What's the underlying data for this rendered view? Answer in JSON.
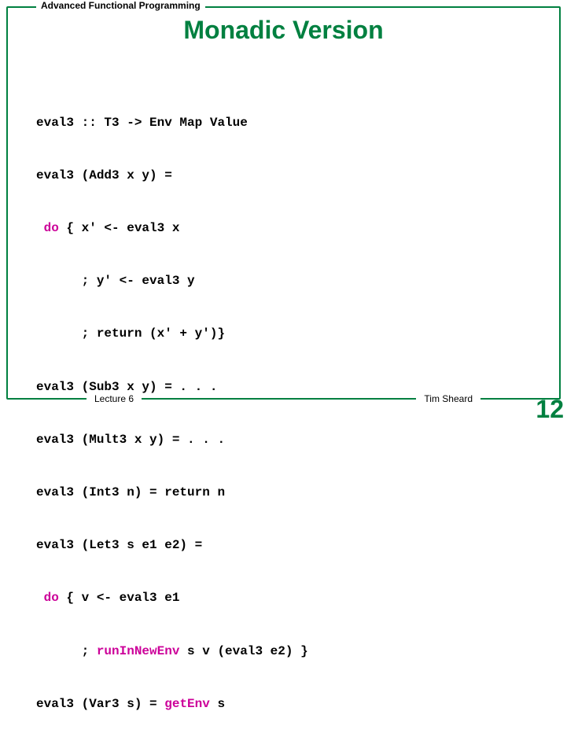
{
  "header": {
    "course": "Advanced Functional Programming"
  },
  "title": "Monadic Version",
  "code": {
    "lines": [
      {
        "pre": "eval3 :: T3 -> Env Map Value"
      },
      {
        "pre": "eval3 (Add3 x y) = "
      },
      {
        "pre": " ",
        "kw": "do",
        "post": " { x' <- eval3 x"
      },
      {
        "pre": "      ; y' <- eval3 y"
      },
      {
        "pre": "      ; return (x' + y')}"
      },
      {
        "pre": "eval3 (Sub3 x y) = . . ."
      },
      {
        "pre": "eval3 (Mult3 x y) = . . ."
      },
      {
        "pre": "eval3 (Int3 n) = return n"
      },
      {
        "pre": "eval3 (Let3 s e1 e2) = "
      },
      {
        "pre": " ",
        "kw": "do",
        "post": " { v <- eval3 e1"
      },
      {
        "pre": "      ; ",
        "kw": "runInNewEnv",
        "post": " s v (eval3 e2) }"
      },
      {
        "pre": "eval3 (Var3 s) = ",
        "kw": "getEnv",
        "post": " s"
      }
    ]
  },
  "footer": {
    "lecture": "Lecture 6",
    "author": "Tim Sheard",
    "page": "12"
  }
}
